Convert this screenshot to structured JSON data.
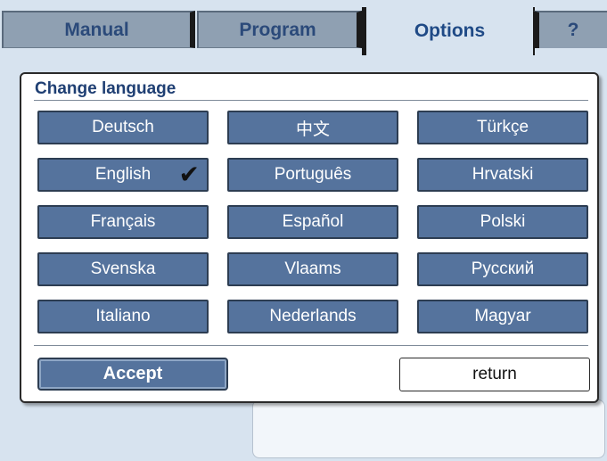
{
  "tabs": {
    "manual": "Manual",
    "program": "Program",
    "options": "Options",
    "help": "?"
  },
  "dialog": {
    "title": "Change language",
    "languages": [
      "Deutsch",
      "中文",
      "Türkçe",
      "English",
      "Português",
      "Hrvatski",
      "Français",
      "Español",
      "Polski",
      "Svenska",
      "Vlaams",
      "Русский",
      "Italiano",
      "Nederlands",
      "Magyar"
    ],
    "selected_language": "English",
    "selected_mark": "✔",
    "accept_label": "Accept",
    "return_label": "return"
  },
  "colors": {
    "background": "#d7e3ef",
    "tab_inactive": "#8fa0b2",
    "button_fill": "#55739d",
    "title_text": "#1f3f73"
  }
}
